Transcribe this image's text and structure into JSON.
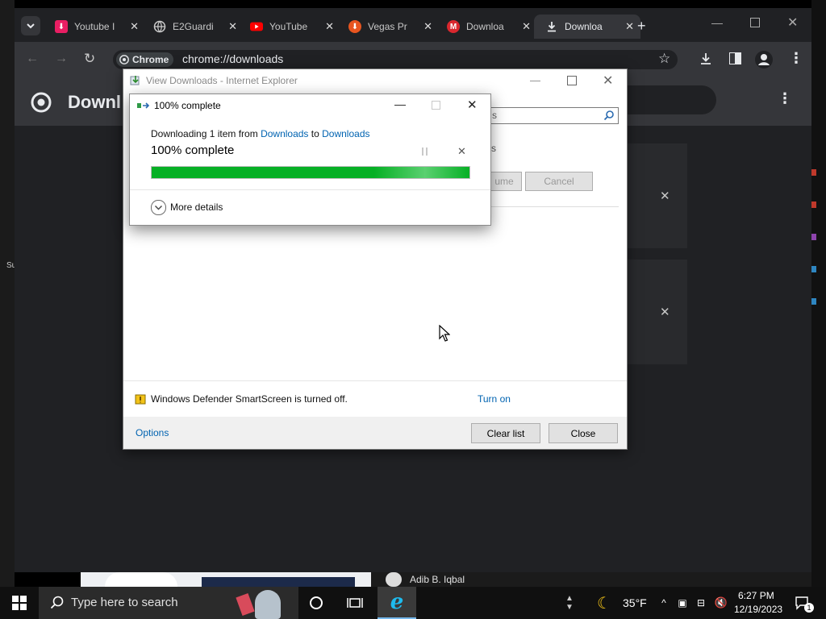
{
  "browser": {
    "tabs": [
      {
        "label": "Youtube I",
        "icon": "download-pink-icon"
      },
      {
        "label": "E2Guardi",
        "icon": "globe-icon"
      },
      {
        "label": "YouTube",
        "icon": "youtube-icon"
      },
      {
        "label": "Vegas Pr",
        "icon": "vegas-icon"
      },
      {
        "label": "Downloa",
        "icon": "mega-icon"
      },
      {
        "label": "Downloa",
        "icon": "download-icon",
        "active": true
      }
    ],
    "chip_label": "Chrome",
    "url": "chrome://downloads",
    "page_title": "Downl"
  },
  "ie_window": {
    "title": "View Downloads - Internet Explorer",
    "bg_snippets": {
      "search_tail": "s",
      "row_tail": "s",
      "resume_label": "ume",
      "cancel_label": "Cancel"
    },
    "smartscreen_text": "Windows Defender SmartScreen is turned off.",
    "turn_on_label": "Turn on",
    "options_label": "Options",
    "clear_list_label": "Clear list",
    "close_label": "Close"
  },
  "progress_dialog": {
    "title": "100% complete",
    "line_prefix": "Downloading 1 item from ",
    "from_link": "Downloads",
    "line_mid": " to ",
    "to_link": "Downloads",
    "status": "100% complete",
    "progress_fraction": 1.0,
    "more_details_label": "More details"
  },
  "behind": {
    "left_edge_text": "Su",
    "channel_name": "Adib B. Iqbal"
  },
  "taskbar": {
    "search_placeholder": "Type here to search",
    "weather_temp": "35°F",
    "time": "6:27 PM",
    "date": "12/19/2023",
    "notification_count": "1"
  },
  "colors": {
    "progress_green": "#06b025",
    "link_blue": "#0063b1",
    "chrome_dark": "#202124"
  }
}
